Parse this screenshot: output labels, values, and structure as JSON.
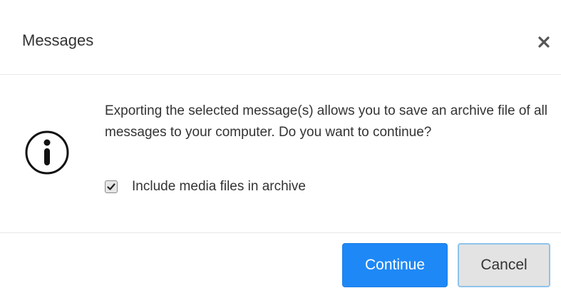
{
  "dialog": {
    "title": "Messages",
    "close_icon": "close-icon",
    "info_icon": "info-circle-icon",
    "message": "Exporting the selected message(s) allows you to save an archive file of all messages to your computer. Do you want to continue?",
    "checkbox": {
      "label": "Include media files in archive",
      "checked": true
    },
    "buttons": {
      "continue_label": "Continue",
      "cancel_label": "Cancel"
    },
    "colors": {
      "primary": "#1e88f6",
      "cancel_bg": "#e3e3e3",
      "cancel_border": "#8ec3ec"
    }
  }
}
